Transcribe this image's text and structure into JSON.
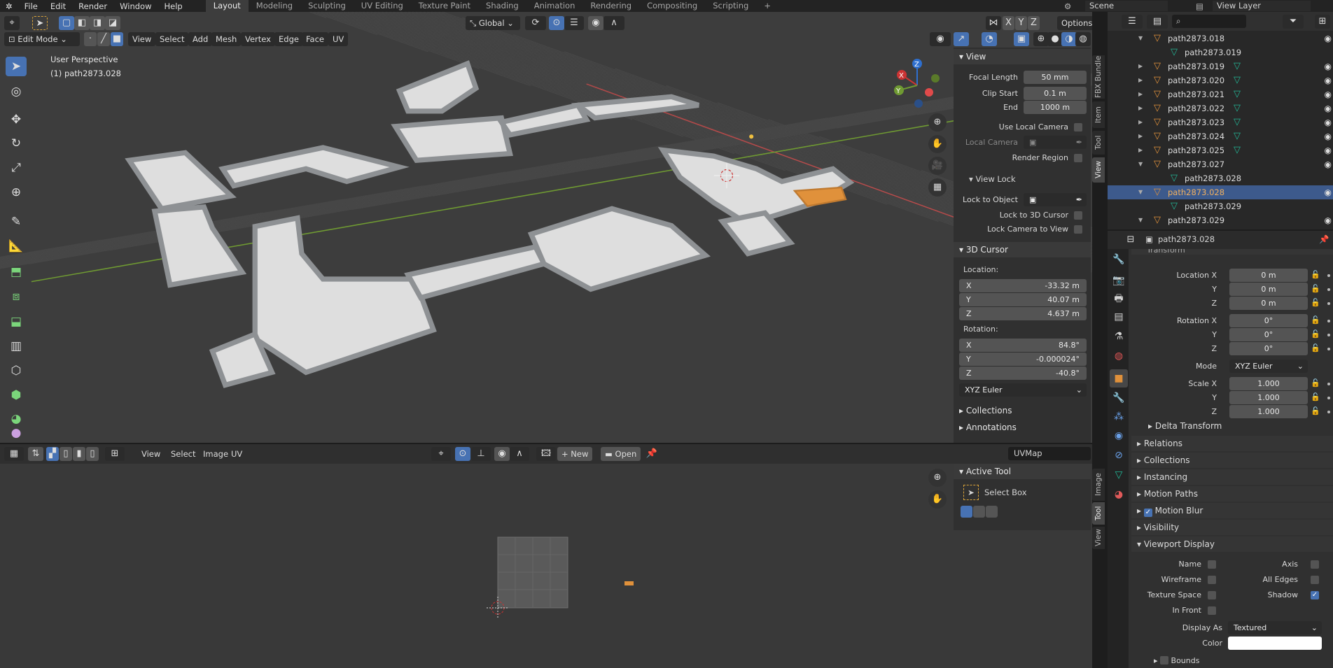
{
  "topbar": {
    "menus": [
      "File",
      "Edit",
      "Render",
      "Window",
      "Help"
    ],
    "workspaces": [
      "Layout",
      "Modeling",
      "Sculpting",
      "UV Editing",
      "Texture Paint",
      "Shading",
      "Animation",
      "Rendering",
      "Compositing",
      "Scripting"
    ],
    "active_workspace": "Layout",
    "add_tab": "+",
    "scene": "Scene",
    "view_layer": "View Layer"
  },
  "viewport": {
    "header": {
      "orientation": "Global",
      "mode": "Edit Mode",
      "menus": [
        "View",
        "Select",
        "Add",
        "Mesh",
        "Vertex",
        "Edge",
        "Face",
        "UV"
      ],
      "axes": [
        "X",
        "Y",
        "Z"
      ],
      "options": "Options"
    },
    "overlay": {
      "perspective": "User Perspective",
      "object": "(1) path2873.028"
    },
    "gizmo": {
      "x": "X",
      "y": "Y",
      "z": "Z"
    },
    "sidebar": {
      "tabs": [
        "FBX Bundle",
        "Item",
        "Tool",
        "View"
      ],
      "active_tab": "View",
      "view": {
        "title": "View",
        "focal_length_label": "Focal Length",
        "focal_length": "50 mm",
        "clip_start_label": "Clip Start",
        "clip_start": "0.1 m",
        "end_label": "End",
        "end": "1000 m",
        "use_local_camera": "Use Local Camera",
        "local_camera": "Local Camera",
        "render_region": "Render Region"
      },
      "view_lock": {
        "title": "View Lock",
        "lock_to_object": "Lock to Object",
        "lock_to_3d_cursor": "Lock to 3D Cursor",
        "lock_camera_to_view": "Lock Camera to View"
      },
      "cursor": {
        "title": "3D Cursor",
        "location_label": "Location:",
        "loc": [
          {
            "axis": "X",
            "value": "-33.32 m"
          },
          {
            "axis": "Y",
            "value": "40.07 m"
          },
          {
            "axis": "Z",
            "value": "4.637 m"
          }
        ],
        "rotation_label": "Rotation:",
        "rot": [
          {
            "axis": "X",
            "value": "84.8°"
          },
          {
            "axis": "Y",
            "value": "-0.000024°"
          },
          {
            "axis": "Z",
            "value": "-40.8°"
          }
        ],
        "mode": "XYZ Euler"
      },
      "collections": "Collections",
      "annotations": "Annotations"
    },
    "colors": {
      "background": "#3d3d3d",
      "x_axis": "#c14b4b",
      "y_axis": "#6f9a32",
      "mesh": "#e3e3e3",
      "wall": "#8e9194",
      "selected": "#e0913b"
    }
  },
  "outliner": {
    "rows": [
      {
        "name": "path2873.018",
        "type": "object",
        "expanded": true,
        "indent": 1
      },
      {
        "name": "path2873.019",
        "type": "mesh",
        "indent": 2
      },
      {
        "name": "path2873.019",
        "type": "object",
        "indent": 1,
        "has_mesh": true
      },
      {
        "name": "path2873.020",
        "type": "object",
        "indent": 1,
        "has_mesh": true
      },
      {
        "name": "path2873.021",
        "type": "object",
        "indent": 1,
        "has_mesh": true
      },
      {
        "name": "path2873.022",
        "type": "object",
        "indent": 1,
        "has_mesh": true
      },
      {
        "name": "path2873.023",
        "type": "object",
        "indent": 1,
        "has_mesh": true
      },
      {
        "name": "path2873.024",
        "type": "object",
        "indent": 1,
        "has_mesh": true
      },
      {
        "name": "path2873.025",
        "type": "object",
        "indent": 1,
        "has_mesh": true
      },
      {
        "name": "path2873.027",
        "type": "object",
        "expanded": true,
        "indent": 1
      },
      {
        "name": "path2873.028",
        "type": "mesh",
        "indent": 2
      },
      {
        "name": "path2873.028",
        "type": "object",
        "expanded": true,
        "indent": 1,
        "selected": true
      },
      {
        "name": "path2873.029",
        "type": "mesh",
        "indent": 2
      },
      {
        "name": "path2873.029",
        "type": "object",
        "expanded": true,
        "indent": 1
      }
    ]
  },
  "properties": {
    "object_name": "path2873.028",
    "section_cut": "Transform",
    "location": {
      "label": "Location X",
      "values": [
        "0 m",
        "0 m",
        "0 m"
      ]
    },
    "rotation": {
      "label": "Rotation X",
      "values": [
        "0°",
        "0°",
        "0°"
      ]
    },
    "mode_label": "Mode",
    "mode": "XYZ Euler",
    "scale": {
      "label": "Scale X",
      "values": [
        "1.000",
        "1.000",
        "1.000"
      ]
    },
    "axis_labels": [
      "Y",
      "Z"
    ],
    "sections": [
      "Delta Transform",
      "Relations",
      "Collections",
      "Instancing",
      "Motion Paths",
      "Motion Blur",
      "Visibility",
      "Viewport Display"
    ],
    "viewport_display": {
      "name": "Name",
      "axis": "Axis",
      "wireframe": "Wireframe",
      "all_edges": "All Edges",
      "texture_space": "Texture Space",
      "shadow": "Shadow",
      "in_front": "In Front",
      "display_as_label": "Display As",
      "display_as": "Textured",
      "color_label": "Color",
      "color": "#ffffff",
      "bounds": "Bounds"
    }
  },
  "uv_editor": {
    "menus": [
      "View",
      "Select",
      "Image",
      "UV"
    ],
    "new": "New",
    "open": "Open",
    "uvmap": "UVMap",
    "active_tool": {
      "title": "Active Tool",
      "tool": "Select Box"
    },
    "tabs": [
      "Image",
      "Tool",
      "View"
    ]
  }
}
